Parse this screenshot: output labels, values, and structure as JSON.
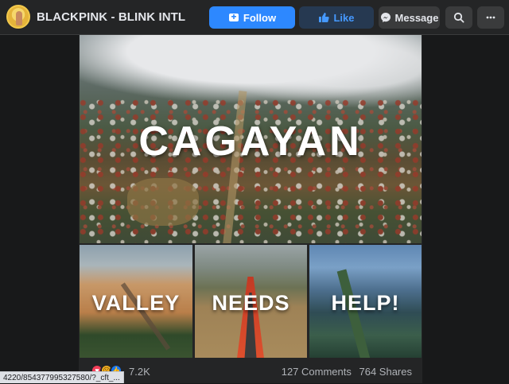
{
  "header": {
    "page_name": "BLACKPINK - BLINK INTL",
    "follow_label": "Follow",
    "like_label": "Like",
    "message_label": "Message",
    "search_icon": "search-icon",
    "more_icon": "more-icon"
  },
  "post": {
    "main_image_text": "CAGAYAN",
    "tiles": [
      "VALLEY",
      "NEEDS",
      "HELP!"
    ],
    "reactions": [
      "love",
      "sad",
      "like"
    ],
    "reaction_count": "7.2K",
    "comments": "127 Comments",
    "shares": "764 Shares"
  },
  "status_url": "4220/854377995327580/?_cft_..."
}
